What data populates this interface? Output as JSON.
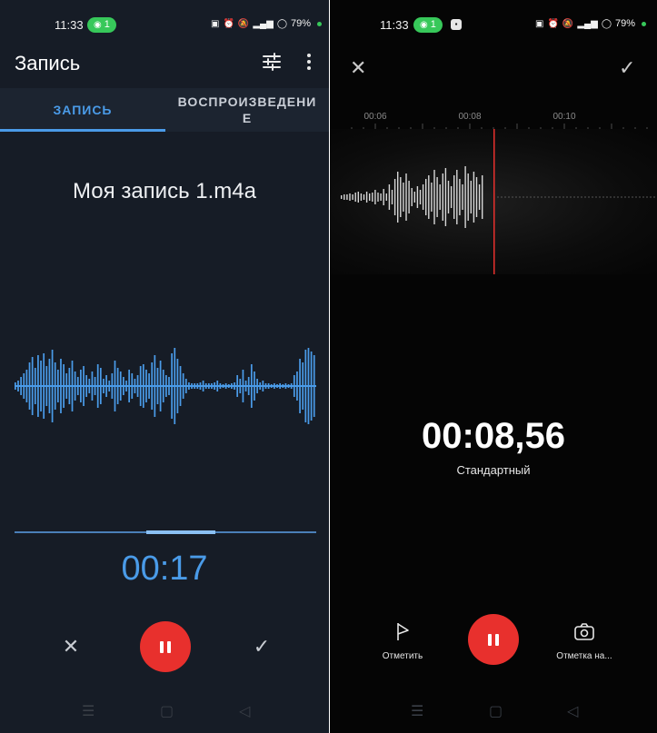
{
  "left": {
    "status": {
      "time": "11:33",
      "pill_label": "1",
      "battery": "79%"
    },
    "appbar": {
      "title": "Запись"
    },
    "tabs": [
      {
        "label": "ЗАПИСЬ",
        "active": true
      },
      {
        "label": "ВОСПРОИЗВЕДЕНИЕ",
        "active": false
      }
    ],
    "filename": "Моя запись 1.m4a",
    "progress": 0.55,
    "timer": "00:17",
    "colors": {
      "accent": "#4a9be8",
      "record": "#e8302d",
      "background": "#161c26"
    }
  },
  "right": {
    "status": {
      "time": "11:33",
      "pill_label": "1",
      "battery": "79%"
    },
    "timeline": {
      "ticks": [
        "00:06",
        "00:08",
        "00:10"
      ]
    },
    "timer": "00:08,56",
    "mode": "Стандартный",
    "actions": {
      "mark": "Отметить",
      "photo_mark": "Отметка на..."
    },
    "colors": {
      "playhead": "#e8302d",
      "record": "#e8302d",
      "background": "#050505"
    }
  },
  "icons": {
    "equalizer": "sliders-icon",
    "more": "more-vertical-icon",
    "close": "close-icon",
    "confirm": "check-icon",
    "pause": "pause-icon",
    "flag": "flag-icon",
    "camera": "camera-icon",
    "nav_recents": "menu-icon",
    "nav_home": "home-icon",
    "nav_back": "back-icon"
  }
}
